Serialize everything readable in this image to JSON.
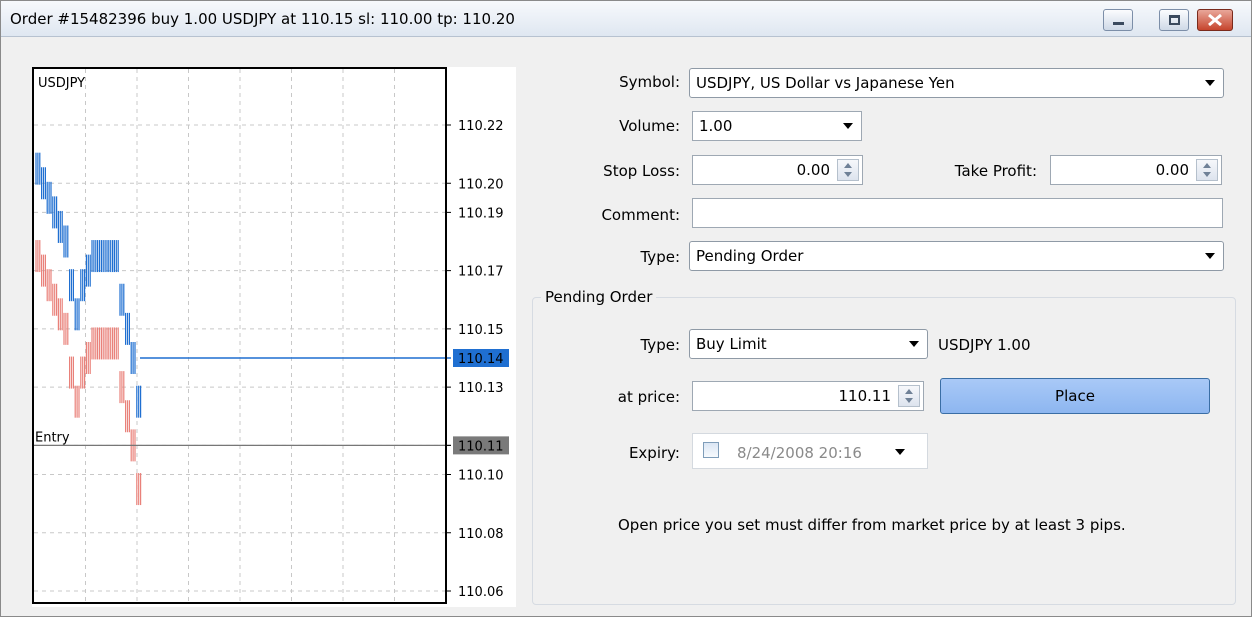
{
  "window": {
    "title": "Order #15482396 buy 1.00 USDJPY at 110.15 sl: 110.00 tp: 110.20"
  },
  "chart": {
    "symbol": "USDJPY",
    "entry_label": "Entry",
    "price_ticks": [
      "110.22",
      "110.20",
      "110.19",
      "110.17",
      "110.15",
      "110.13",
      "110.11",
      "110.10",
      "110.08",
      "110.06"
    ],
    "current_price_tag": "110.14",
    "entry_price_tag": "110.11",
    "colors": {
      "ask": "#1f6fd1",
      "bid": "#e9817a",
      "current_tag": "#1f6fd1",
      "entry_tag": "#7a7a7a",
      "grid": "#c8c8c8"
    }
  },
  "chart_data": {
    "type": "line",
    "title": "USDJPY",
    "ylim": [
      110.06,
      110.23
    ],
    "y_ticks": [
      110.22,
      110.2,
      110.19,
      110.17,
      110.15,
      110.13,
      110.11,
      110.1,
      110.08,
      110.06
    ],
    "series": [
      {
        "values": [
          110.205,
          110.2,
          110.195,
          110.19,
          110.185,
          110.18,
          110.165,
          110.155,
          110.165,
          110.17,
          110.175,
          110.175,
          110.175,
          110.175,
          110.175,
          110.16,
          110.15,
          110.14,
          110.125,
          110.14,
          110.14,
          110.14,
          110.14,
          110.14,
          110.14,
          110.14,
          110.14,
          110.14,
          110.14,
          110.14,
          110.14,
          110.14,
          110.14,
          110.14,
          110.14
        ]
      },
      {
        "values": [
          110.175,
          110.17,
          110.165,
          110.16,
          110.155,
          110.15,
          110.135,
          110.125,
          110.135,
          110.14,
          110.145,
          110.145,
          110.145,
          110.145,
          110.145,
          110.13,
          110.12,
          110.11,
          110.095
        ]
      }
    ],
    "hlines": [
      {
        "label": "Entry",
        "y": 110.11
      },
      {
        "y": 110.14
      }
    ]
  },
  "form": {
    "symbol_label": "Symbol:",
    "symbol_value": "USDJPY, US Dollar vs Japanese Yen",
    "volume_label": "Volume:",
    "volume_value": "1.00",
    "stop_loss_label": "Stop Loss:",
    "stop_loss_value": "0.00",
    "take_profit_label": "Take Profit:",
    "take_profit_value": "0.00",
    "comment_label": "Comment:",
    "comment_value": "",
    "type_label": "Type:",
    "type_value": "Pending Order"
  },
  "pending": {
    "group_title": "Pending Order",
    "type_label": "Type:",
    "type_value": "Buy Limit",
    "order_summary": "USDJPY 1.00",
    "price_label": "at price:",
    "price_value": "110.11",
    "place_label": "Place",
    "expiry_label": "Expiry:",
    "expiry_value": "8/24/2008 20:16",
    "hint": "Open price you set must differ from market price by at least 3 pips."
  }
}
